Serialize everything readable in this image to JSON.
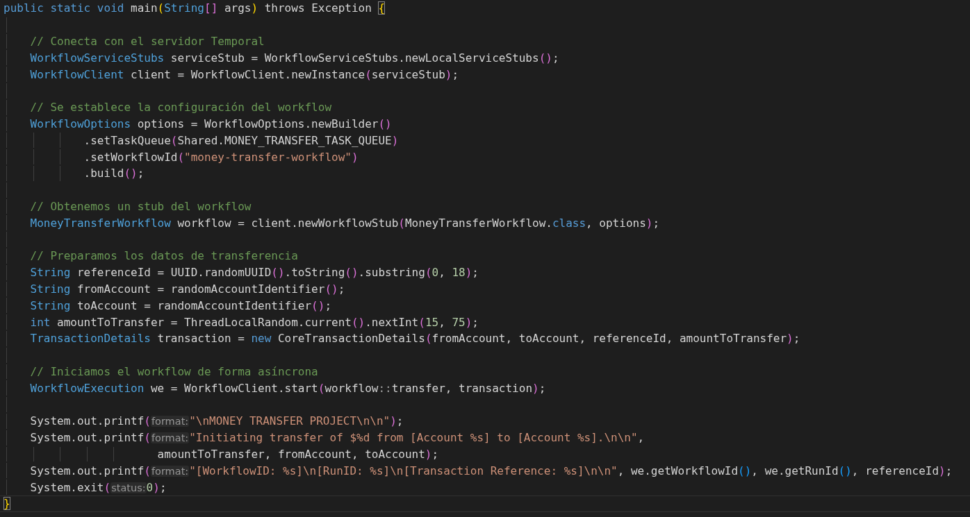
{
  "editor": {
    "lines": [
      {
        "kind": "top",
        "current": false,
        "tokens": [
          {
            "text": "public static void",
            "kind": "keyword"
          },
          {
            "text": " main",
            "kind": "plain"
          },
          {
            "text": "(",
            "kind": "paren1"
          },
          {
            "text": "String",
            "kind": "type"
          },
          {
            "text": "[]",
            "kind": "paren2"
          },
          {
            "text": " args",
            "kind": "plain"
          },
          {
            "text": ")",
            "kind": "paren1"
          },
          {
            "text": " throws Exception ",
            "kind": "plain"
          },
          {
            "text": "{",
            "kind": "match"
          }
        ]
      },
      {
        "kind": "blank",
        "current": false
      },
      {
        "kind": "body",
        "current": false,
        "tokens": [
          {
            "text": "// Conecta con el servidor Temporal",
            "kind": "comment"
          }
        ]
      },
      {
        "kind": "body",
        "current": false,
        "tokens": [
          {
            "text": "WorkflowServiceStubs",
            "kind": "type"
          },
          {
            "text": " serviceStub = WorkflowServiceStubs.newLocalServiceStubs",
            "kind": "plain"
          },
          {
            "text": "()",
            "kind": "paren2"
          },
          {
            "text": ";",
            "kind": "plain"
          }
        ]
      },
      {
        "kind": "body",
        "current": false,
        "tokens": [
          {
            "text": "WorkflowClient",
            "kind": "type"
          },
          {
            "text": " client = WorkflowClient.newInstance",
            "kind": "plain"
          },
          {
            "text": "(",
            "kind": "paren2"
          },
          {
            "text": "serviceStub",
            "kind": "plain"
          },
          {
            "text": ")",
            "kind": "paren2"
          },
          {
            "text": ";",
            "kind": "plain"
          }
        ]
      },
      {
        "kind": "blank",
        "current": false
      },
      {
        "kind": "body",
        "current": false,
        "tokens": [
          {
            "text": "// Se establece la configuración del workflow",
            "kind": "comment"
          }
        ]
      },
      {
        "kind": "body",
        "current": false,
        "tokens": [
          {
            "text": "WorkflowOptions",
            "kind": "type"
          },
          {
            "text": " options = WorkflowOptions.newBuilder",
            "kind": "plain"
          },
          {
            "text": "()",
            "kind": "paren2"
          }
        ]
      },
      {
        "kind": "chain",
        "current": false,
        "tokens": [
          {
            "text": ".setTaskQueue",
            "kind": "plain"
          },
          {
            "text": "(",
            "kind": "paren2"
          },
          {
            "text": "Shared.MONEY_TRANSFER_TASK_QUEUE",
            "kind": "plain"
          },
          {
            "text": ")",
            "kind": "paren2"
          }
        ]
      },
      {
        "kind": "chain",
        "current": false,
        "tokens": [
          {
            "text": ".setWorkflowId",
            "kind": "plain"
          },
          {
            "text": "(",
            "kind": "paren2"
          },
          {
            "text": "\"money-transfer-workflow\"",
            "kind": "string"
          },
          {
            "text": ")",
            "kind": "paren2"
          }
        ]
      },
      {
        "kind": "chain",
        "current": false,
        "tokens": [
          {
            "text": ".build",
            "kind": "plain"
          },
          {
            "text": "()",
            "kind": "paren2"
          },
          {
            "text": ";",
            "kind": "plain"
          }
        ]
      },
      {
        "kind": "blank",
        "current": false
      },
      {
        "kind": "body",
        "current": false,
        "tokens": [
          {
            "text": "// Obtenemos un stub del workflow",
            "kind": "comment"
          }
        ]
      },
      {
        "kind": "body",
        "current": false,
        "tokens": [
          {
            "text": "MoneyTransferWorkflow",
            "kind": "type"
          },
          {
            "text": " workflow = client.newWorkflowStub",
            "kind": "plain"
          },
          {
            "text": "(",
            "kind": "paren2"
          },
          {
            "text": "MoneyTransferWorkflow.",
            "kind": "plain"
          },
          {
            "text": "class",
            "kind": "keyword"
          },
          {
            "text": ", options",
            "kind": "plain"
          },
          {
            "text": ")",
            "kind": "paren2"
          },
          {
            "text": ";",
            "kind": "plain"
          }
        ]
      },
      {
        "kind": "blank",
        "current": false
      },
      {
        "kind": "body",
        "current": false,
        "tokens": [
          {
            "text": "// Preparamos los datos de transferencia",
            "kind": "comment"
          }
        ]
      },
      {
        "kind": "body",
        "current": false,
        "tokens": [
          {
            "text": "String",
            "kind": "type"
          },
          {
            "text": " referenceId = UUID.randomUUID",
            "kind": "plain"
          },
          {
            "text": "()",
            "kind": "paren2"
          },
          {
            "text": ".toString",
            "kind": "plain"
          },
          {
            "text": "()",
            "kind": "paren2"
          },
          {
            "text": ".substring",
            "kind": "plain"
          },
          {
            "text": "(",
            "kind": "paren2"
          },
          {
            "text": "0",
            "kind": "number"
          },
          {
            "text": ", ",
            "kind": "plain"
          },
          {
            "text": "18",
            "kind": "number"
          },
          {
            "text": ")",
            "kind": "paren2"
          },
          {
            "text": ";",
            "kind": "plain"
          }
        ]
      },
      {
        "kind": "body",
        "current": false,
        "tokens": [
          {
            "text": "String",
            "kind": "type"
          },
          {
            "text": " fromAccount = randomAccountIdentifier",
            "kind": "plain"
          },
          {
            "text": "()",
            "kind": "paren2"
          },
          {
            "text": ";",
            "kind": "plain"
          }
        ]
      },
      {
        "kind": "body",
        "current": false,
        "tokens": [
          {
            "text": "String",
            "kind": "type"
          },
          {
            "text": " toAccount = randomAccountIdentifier",
            "kind": "plain"
          },
          {
            "text": "()",
            "kind": "paren2"
          },
          {
            "text": ";",
            "kind": "plain"
          }
        ]
      },
      {
        "kind": "body",
        "current": false,
        "tokens": [
          {
            "text": "int",
            "kind": "keyword"
          },
          {
            "text": " amountToTransfer = ThreadLocalRandom.current",
            "kind": "plain"
          },
          {
            "text": "()",
            "kind": "paren2"
          },
          {
            "text": ".nextInt",
            "kind": "plain"
          },
          {
            "text": "(",
            "kind": "paren2"
          },
          {
            "text": "15",
            "kind": "number"
          },
          {
            "text": ", ",
            "kind": "plain"
          },
          {
            "text": "75",
            "kind": "number"
          },
          {
            "text": ")",
            "kind": "paren2"
          },
          {
            "text": ";",
            "kind": "plain"
          }
        ]
      },
      {
        "kind": "body",
        "current": false,
        "tokens": [
          {
            "text": "TransactionDetails",
            "kind": "type"
          },
          {
            "text": " transaction = ",
            "kind": "plain"
          },
          {
            "text": "new",
            "kind": "keyword"
          },
          {
            "text": " CoreTransactionDetails",
            "kind": "plain"
          },
          {
            "text": "(",
            "kind": "paren2"
          },
          {
            "text": "fromAccount, toAccount, referenceId, amountToTransfer",
            "kind": "plain"
          },
          {
            "text": ")",
            "kind": "paren2"
          },
          {
            "text": ";",
            "kind": "plain"
          }
        ]
      },
      {
        "kind": "blank",
        "current": false
      },
      {
        "kind": "body",
        "current": false,
        "tokens": [
          {
            "text": "// Iniciamos el workflow de forma asíncrona",
            "kind": "comment"
          }
        ]
      },
      {
        "kind": "body",
        "current": false,
        "tokens": [
          {
            "text": "WorkflowExecution",
            "kind": "type"
          },
          {
            "text": " we = WorkflowClient.start",
            "kind": "plain"
          },
          {
            "text": "(",
            "kind": "paren2"
          },
          {
            "text": "workflow",
            "kind": "plain"
          },
          {
            "text": "::",
            "kind": "operator"
          },
          {
            "text": "transfer, transaction",
            "kind": "plain"
          },
          {
            "text": ")",
            "kind": "paren2"
          },
          {
            "text": ";",
            "kind": "plain"
          }
        ]
      },
      {
        "kind": "blank",
        "current": false
      },
      {
        "kind": "body",
        "current": false,
        "tokens": [
          {
            "text": "System.out.printf",
            "kind": "plain"
          },
          {
            "text": "(",
            "kind": "paren2"
          },
          {
            "text": "format:",
            "kind": "hint"
          },
          {
            "text": "\"\\nMONEY TRANSFER PROJECT\\n\\n\"",
            "kind": "string"
          },
          {
            "text": ")",
            "kind": "paren2"
          },
          {
            "text": ";",
            "kind": "plain"
          }
        ]
      },
      {
        "kind": "body",
        "current": false,
        "tokens": [
          {
            "text": "System.out.printf",
            "kind": "plain"
          },
          {
            "text": "(",
            "kind": "paren2"
          },
          {
            "text": "format:",
            "kind": "hint"
          },
          {
            "text": "\"Initiating transfer of $%d from [Account %s] to [Account %s].\\n\\n\"",
            "kind": "string"
          },
          {
            "text": ",",
            "kind": "plain"
          }
        ]
      },
      {
        "kind": "wrap",
        "current": false,
        "tokens": [
          {
            "text": "amountToTransfer, fromAccount, toAccount",
            "kind": "plain"
          },
          {
            "text": ")",
            "kind": "paren2"
          },
          {
            "text": ";",
            "kind": "plain"
          }
        ]
      },
      {
        "kind": "body",
        "current": false,
        "tokens": [
          {
            "text": "System.out.printf",
            "kind": "plain"
          },
          {
            "text": "(",
            "kind": "paren2"
          },
          {
            "text": "format:",
            "kind": "hint"
          },
          {
            "text": "\"[WorkflowID: %s]\\n[RunID: %s]\\n[Transaction Reference: %s]\\n\\n\"",
            "kind": "string"
          },
          {
            "text": ", we.getWorkflowId",
            "kind": "plain"
          },
          {
            "text": "()",
            "kind": "paren3"
          },
          {
            "text": ", we.getRunId",
            "kind": "plain"
          },
          {
            "text": "()",
            "kind": "paren3"
          },
          {
            "text": ", referenceId",
            "kind": "plain"
          },
          {
            "text": ")",
            "kind": "paren2"
          },
          {
            "text": ";",
            "kind": "plain"
          }
        ]
      },
      {
        "kind": "body",
        "current": false,
        "tokens": [
          {
            "text": "System.exit",
            "kind": "plain"
          },
          {
            "text": "(",
            "kind": "paren2"
          },
          {
            "text": "status:",
            "kind": "hint"
          },
          {
            "text": "0",
            "kind": "number"
          },
          {
            "text": ")",
            "kind": "paren2"
          },
          {
            "text": ";",
            "kind": "plain"
          }
        ]
      },
      {
        "kind": "top",
        "current": true,
        "tokens": [
          {
            "text": "}",
            "kind": "match"
          }
        ]
      }
    ]
  }
}
